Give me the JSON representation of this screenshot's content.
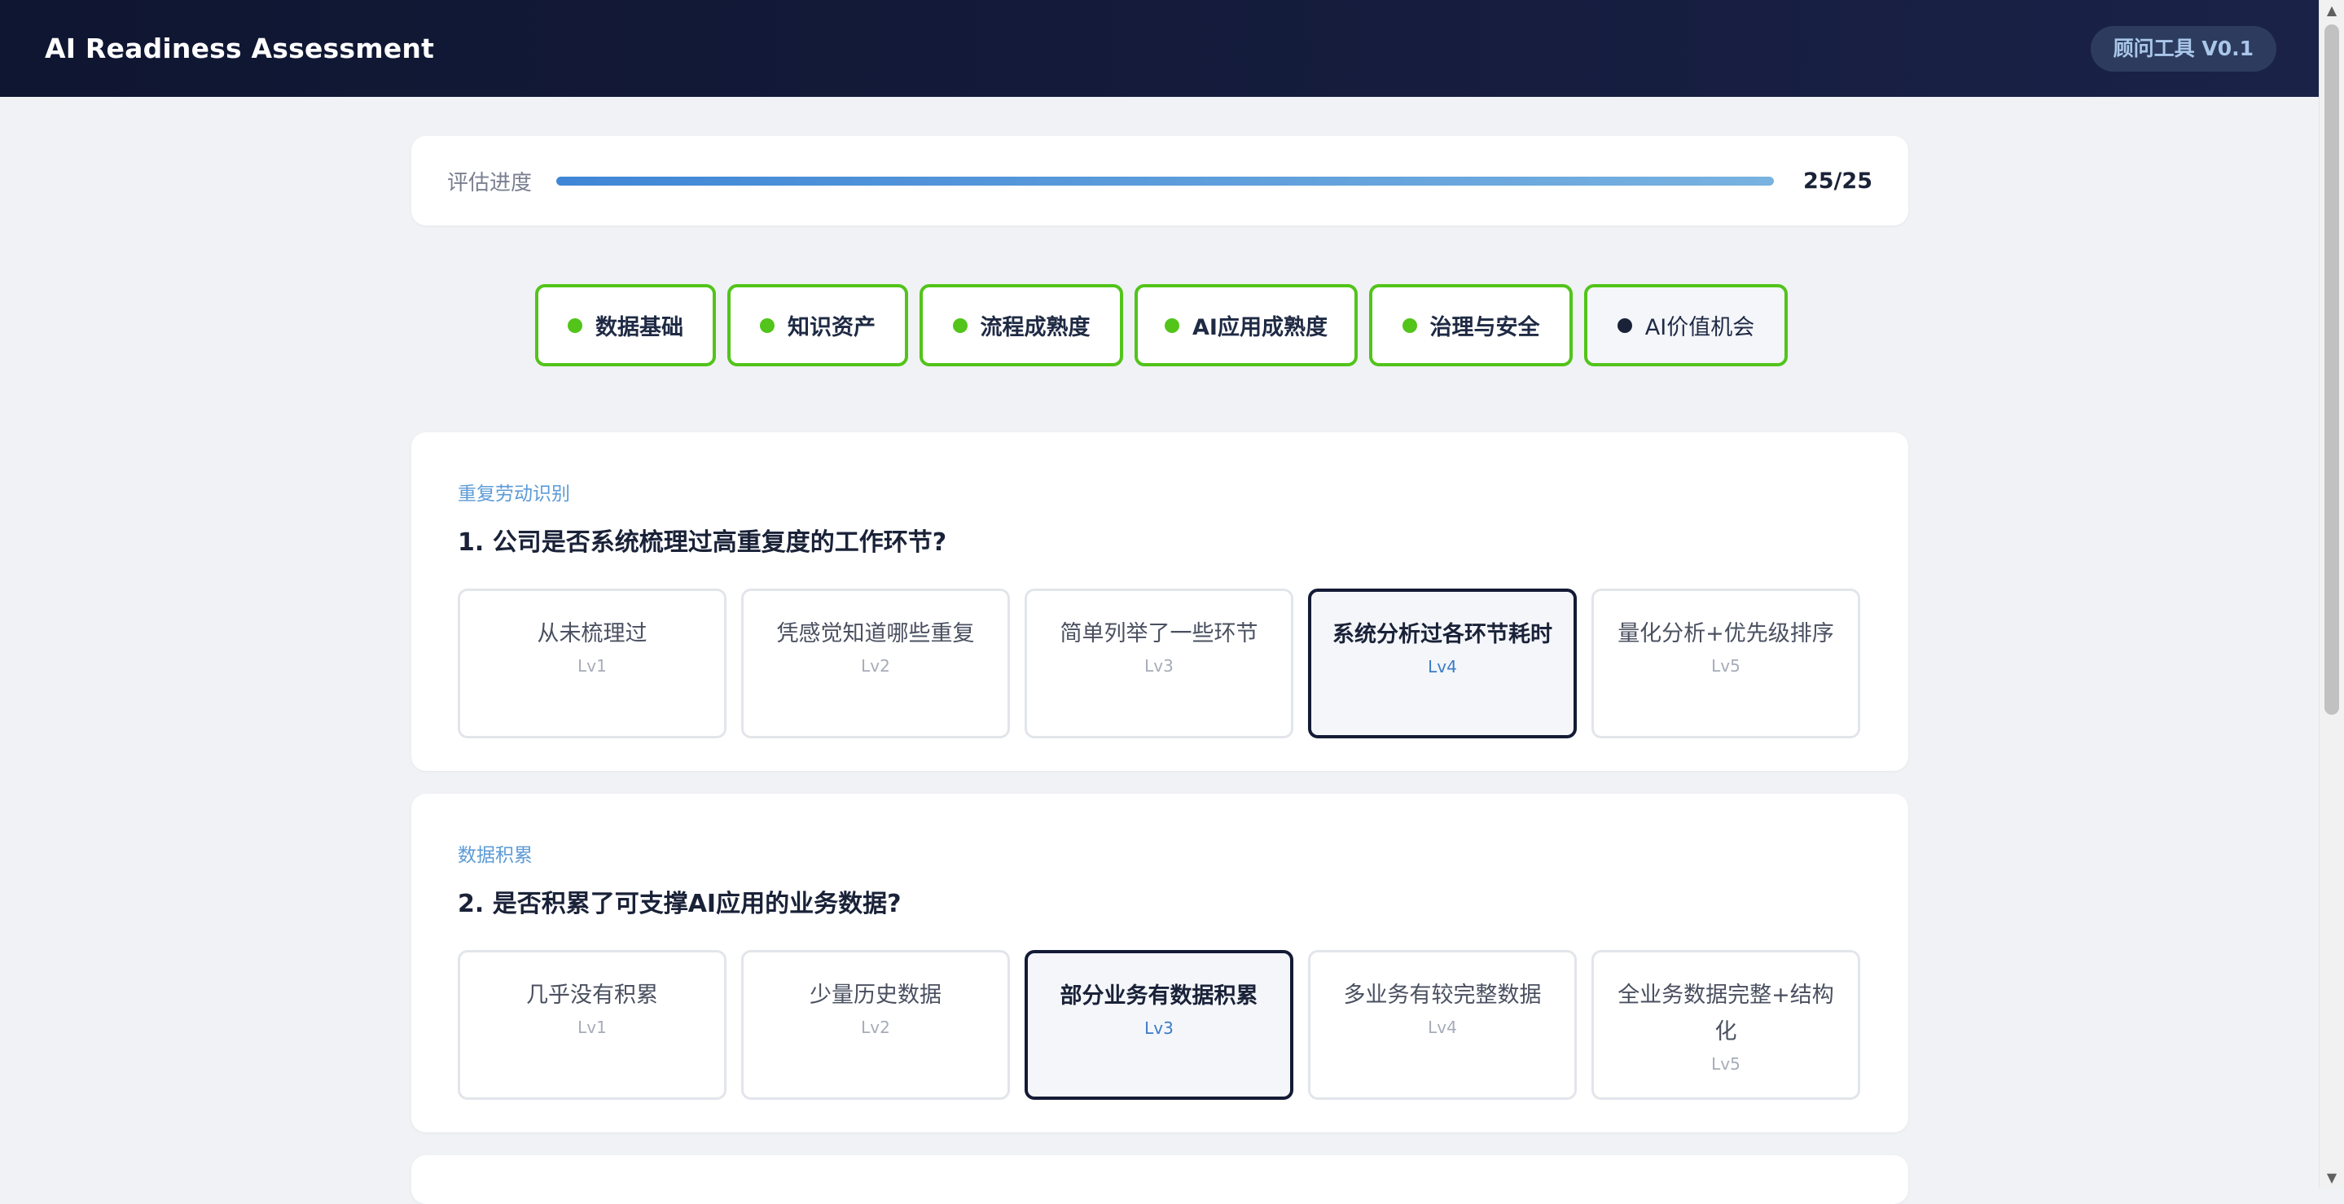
{
  "header": {
    "title": "AI Readiness Assessment",
    "version": "顾问工具 V0.1"
  },
  "progress": {
    "label": "评估进度",
    "count": "25/25",
    "fraction": 1.0
  },
  "tabs": [
    {
      "label": "数据基础",
      "active": false
    },
    {
      "label": "知识资产",
      "active": false
    },
    {
      "label": "流程成熟度",
      "active": false
    },
    {
      "label": "AI应用成熟度",
      "active": false
    },
    {
      "label": "治理与安全",
      "active": false
    },
    {
      "label": "AI价值机会",
      "active": true
    }
  ],
  "questions": [
    {
      "category": "重复劳动识别",
      "title": "1. 公司是否系统梳理过高重复度的工作环节?",
      "options": [
        {
          "text": "从未梳理过",
          "level": "Lv1"
        },
        {
          "text": "凭感觉知道哪些重复",
          "level": "Lv2"
        },
        {
          "text": "简单列举了一些环节",
          "level": "Lv3"
        },
        {
          "text": "系统分析过各环节耗时",
          "level": "Lv4"
        },
        {
          "text": "量化分析+优先级排序",
          "level": "Lv5"
        }
      ],
      "selected": 3
    },
    {
      "category": "数据积累",
      "title": "2. 是否积累了可支撑AI应用的业务数据?",
      "options": [
        {
          "text": "几乎没有积累",
          "level": "Lv1"
        },
        {
          "text": "少量历史数据",
          "level": "Lv2"
        },
        {
          "text": "部分业务有数据积累",
          "level": "Lv3"
        },
        {
          "text": "多业务有较完整数据",
          "level": "Lv4"
        },
        {
          "text": "全业务数据完整+结构化",
          "level": "Lv5"
        }
      ],
      "selected": 2
    }
  ],
  "colors": {
    "accent": "#52c41a",
    "header_bg": "#0f1631",
    "selected_border": "#141b36",
    "progress": "#3f86d6"
  }
}
